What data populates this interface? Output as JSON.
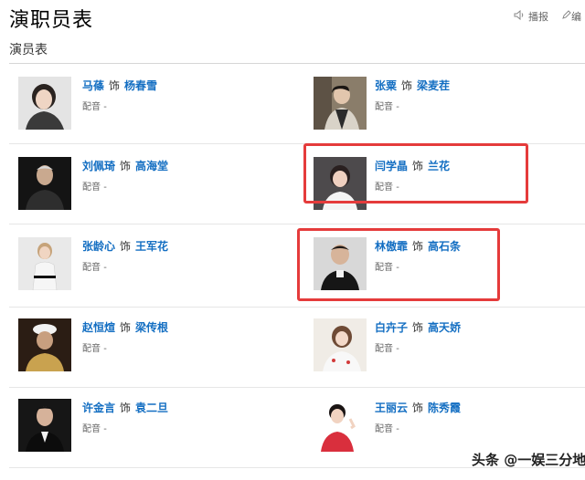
{
  "header": {
    "title": "演职员表",
    "play_label": "播报",
    "edit_label": "编"
  },
  "section": {
    "title": "演员表"
  },
  "cast": [
    {
      "actor": "马蓧",
      "connector": "饰",
      "role": "杨春雪",
      "dub_label": "配音",
      "dub_value": "-",
      "icon": "photo-icon"
    },
    {
      "actor": "张粟",
      "connector": "饰",
      "role": "梁麦茬",
      "dub_label": "配音",
      "dub_value": "-",
      "icon": "photo-icon"
    },
    {
      "actor": "刘佩琦",
      "connector": "饰",
      "role": "高海堂",
      "dub_label": "配音",
      "dub_value": "-",
      "icon": "photo-icon"
    },
    {
      "actor": "闫学晶",
      "connector": "饰",
      "role": "兰花",
      "dub_label": "配音",
      "dub_value": "-",
      "icon": "photo-icon"
    },
    {
      "actor": "张龄心",
      "connector": "饰",
      "role": "王军花",
      "dub_label": "配音",
      "dub_value": "-",
      "icon": "photo-icon"
    },
    {
      "actor": "林傲霏",
      "connector": "饰",
      "role": "高石条",
      "dub_label": "配音",
      "dub_value": "-",
      "icon": "photo-icon"
    },
    {
      "actor": "赵恒煊",
      "connector": "饰",
      "role": "梁传根",
      "dub_label": "配音",
      "dub_value": "-",
      "icon": "photo-icon"
    },
    {
      "actor": "白卉子",
      "connector": "饰",
      "role": "高天娇",
      "dub_label": "配音",
      "dub_value": "-",
      "icon": "photo-icon"
    },
    {
      "actor": "许金言",
      "connector": "饰",
      "role": "袁二旦",
      "dub_label": "配音",
      "dub_value": "-",
      "icon": "photo-icon"
    },
    {
      "actor": "王丽云",
      "connector": "饰",
      "role": "陈秀霞",
      "dub_label": "配音",
      "dub_value": "-",
      "icon": "photo-icon"
    }
  ],
  "watermark": "头条 @一娱三分地",
  "colors": {
    "link": "#136ec2",
    "highlight": "#e53b3b",
    "divider": "#e6e6e6"
  }
}
